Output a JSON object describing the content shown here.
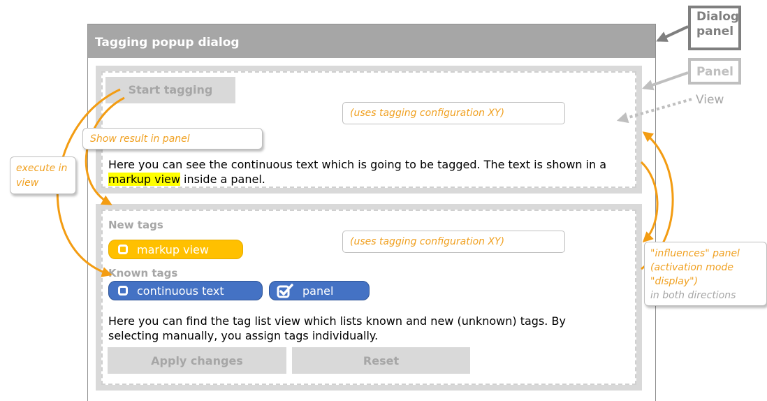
{
  "dialog": {
    "title": "Tagging popup dialog"
  },
  "panel1": {
    "start_button": "Start tagging",
    "config": "(uses tagging configuration XY)",
    "text_before": "Here you can see the continuous text which is going to be tagged. The text is shown in a",
    "text_highlight": "markup view",
    "text_after": " inside a panel."
  },
  "panel2": {
    "new_tags_label": "New tags",
    "config": "(uses tagging configuration XY)",
    "new_tags": [
      {
        "label": "markup view",
        "checked": false
      }
    ],
    "known_tags_label": "Known tags",
    "known_tags": [
      {
        "label": "continuous  text",
        "checked": false
      },
      {
        "label": "panel",
        "checked": true
      }
    ],
    "text_line1": "Here you can find the tag list view which lists known and new (unknown)  tags. By",
    "text_line2": "selecting manually, you assign tags individually.",
    "apply_button": "Apply changes",
    "reset_button": "Reset"
  },
  "callouts": {
    "show_result": "Show result in panel",
    "execute_line1": "execute in",
    "execute_line2": "view",
    "influences_line1": "\"influences\" panel",
    "influences_line2": "(activation mode",
    "influences_line3": "\"display\")",
    "influences_line4": "in both directions"
  },
  "legend": {
    "dialog_line1": "Dialog",
    "dialog_line2": "panel",
    "panel": "Panel",
    "view": "View"
  },
  "colors": {
    "accent_orange": "#f39c12",
    "tag_new": "#ffc000",
    "tag_known": "#4472c4",
    "highlight": "#ffff00"
  }
}
